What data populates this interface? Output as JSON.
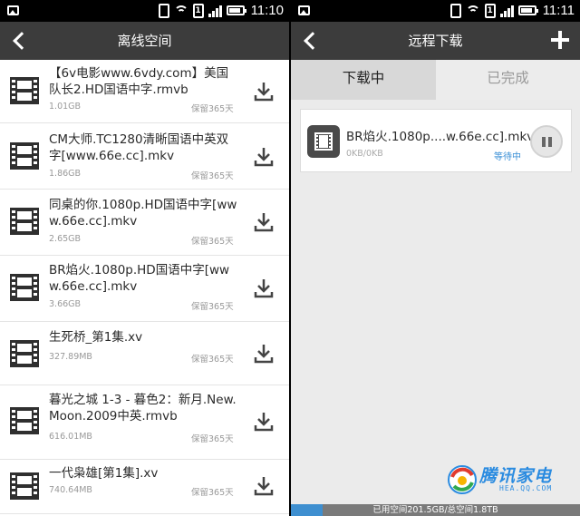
{
  "left": {
    "status_time": "11:10",
    "title": "离线空间",
    "files": [
      {
        "name": "【6v电影www.6vdy.com】美国队长2.HD国语中字.rmvb",
        "size": "1.01GB",
        "keep": "保留365天"
      },
      {
        "name": "CM大师.TC1280清晰国语中英双字[www.66e.cc].mkv",
        "size": "1.86GB",
        "keep": "保留365天"
      },
      {
        "name": "同桌的你.1080p.HD国语中字[www.66e.cc].mkv",
        "size": "2.65GB",
        "keep": "保留365天"
      },
      {
        "name": "BR焰火.1080p.HD国语中字[www.66e.cc].mkv",
        "size": "3.66GB",
        "keep": "保留365天"
      },
      {
        "name": "生死桥_第1集.xv",
        "size": "327.89MB",
        "keep": "保留365天"
      },
      {
        "name": "暮光之城 1-3 - 暮色2：新月.New.Moon.2009中英.rmvb",
        "size": "616.01MB",
        "keep": "保留365天"
      },
      {
        "name": "一代枭雄[第1集].xv",
        "size": "740.64MB",
        "keep": "保留365天"
      }
    ]
  },
  "right": {
    "status_time": "11:11",
    "title": "远程下载",
    "tabs": {
      "downloading": "下载中",
      "completed": "已完成"
    },
    "task": {
      "name": "BR焰火.1080p....w.66e.cc].mkv",
      "progress": "0KB/0KB",
      "status": "等待中"
    },
    "storage": {
      "text": "已用空间201.5GB/总空间1.8TB",
      "used_fraction": 0.11
    },
    "watermark": {
      "cn": "腾讯家电",
      "en": "HEA.QQ.COM"
    }
  },
  "status_sim": "1",
  "colors": {
    "title_bar": "#3c3c3c",
    "accent": "#3a8fd6",
    "storage_fill": "#3e8fd0"
  },
  "icons": {
    "back": "back-arrow-icon",
    "add": "plus-icon",
    "file": "film-icon",
    "download": "download-icon",
    "pause": "pause-icon"
  }
}
